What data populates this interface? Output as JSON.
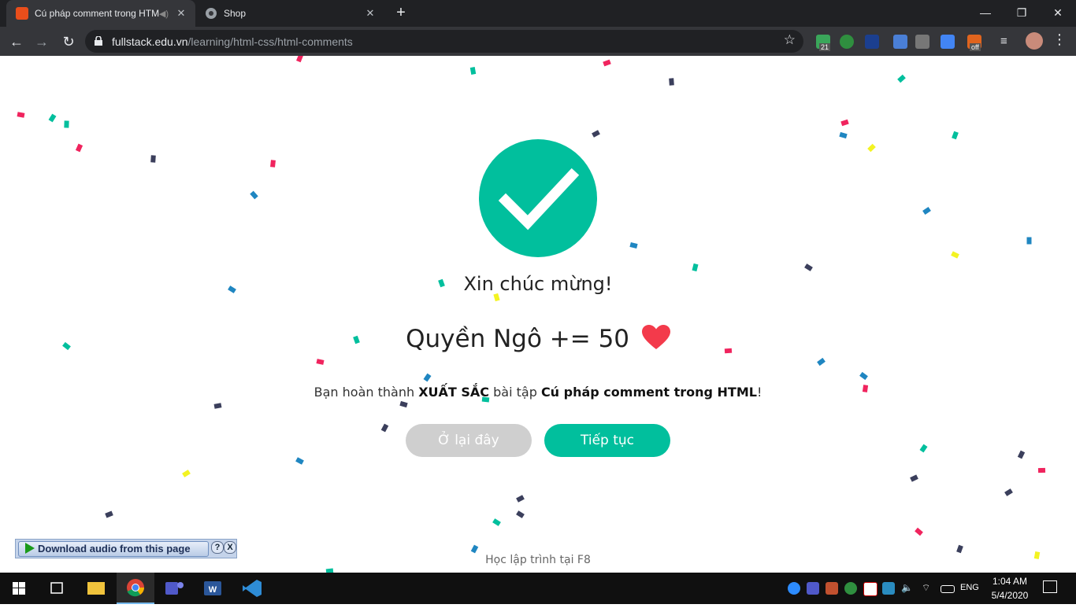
{
  "browser": {
    "tabs": [
      {
        "title": "Cú pháp comment trong HTML",
        "favicon": "f8-logo-icon",
        "active": true
      },
      {
        "title": "Shop",
        "favicon": "globe-icon",
        "active": false
      }
    ],
    "url_host": "fullstack.edu.vn",
    "url_path": "/learning/html-css/html-comments",
    "extension_badges": {
      "badge_21": "21",
      "badge_off": "off"
    }
  },
  "page": {
    "heading": "Xin chúc mừng!",
    "score_text": "Quyền Ngô += 50",
    "message_prefix": "Bạn hoàn thành ",
    "message_strong1": "XUẤT SẮC",
    "message_mid": " bài tập ",
    "message_strong2": "Cú pháp comment trong HTML",
    "message_suffix": "!",
    "stay_button": "Ở lại đây",
    "continue_button": "Tiếp tục",
    "footer": "Học lập trình tại F8",
    "colors": {
      "accent": "#01bf9d",
      "heart": "#f33a4b",
      "disabled": "#cfcfcf"
    }
  },
  "download_bar": {
    "label": "Download audio from this page",
    "help": "?",
    "close": "X"
  },
  "taskbar": {
    "language": "ENG",
    "time": "1:04 AM",
    "date": "5/4/2020"
  }
}
